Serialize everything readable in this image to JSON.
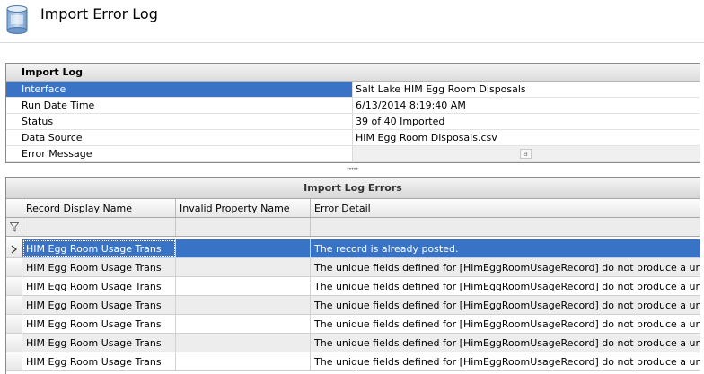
{
  "header": {
    "title": "Import Error Log",
    "icon": "database-icon"
  },
  "import_log": {
    "title": "Import Log",
    "rows": [
      {
        "label": "Interface",
        "value": "Salt Lake HIM Egg Room Disposals"
      },
      {
        "label": "Run Date Time",
        "value": "6/13/2014 8:19:40 AM"
      },
      {
        "label": "Status",
        "value": "39 of 40 Imported"
      },
      {
        "label": "Data Source",
        "value": "HIM Egg Room Disposals.csv"
      },
      {
        "label": "Error Message",
        "value": ""
      }
    ],
    "edit_button_glyph": "a",
    "selection_color": "#3973c6"
  },
  "errors": {
    "title": "Import Log Errors",
    "columns": [
      "Record Display Name",
      "Invalid Property Name",
      "Error Detail"
    ],
    "filter_icon": "filter-icon",
    "row_indicator_icon": "chevron-right-icon",
    "rows": [
      {
        "record": "HIM Egg Room Usage Trans",
        "property": "",
        "detail": "The record is already posted."
      },
      {
        "record": "HIM Egg Room Usage Trans",
        "property": "",
        "detail": "The unique fields defined for [HimEggRoomUsageRecord] do not produce a unique result."
      },
      {
        "record": "HIM Egg Room Usage Trans",
        "property": "",
        "detail": "The unique fields defined for [HimEggRoomUsageRecord] do not produce a unique result."
      },
      {
        "record": "HIM Egg Room Usage Trans",
        "property": "",
        "detail": "The unique fields defined for [HimEggRoomUsageRecord] do not produce a unique result."
      },
      {
        "record": "HIM Egg Room Usage Trans",
        "property": "",
        "detail": "The unique fields defined for [HimEggRoomUsageRecord] do not produce a unique result."
      },
      {
        "record": "HIM Egg Room Usage Trans",
        "property": "",
        "detail": "The unique fields defined for [HimEggRoomUsageRecord] do not produce a unique result."
      },
      {
        "record": "HIM Egg Room Usage Trans",
        "property": "",
        "detail": "The unique fields defined for [HimEggRoomUsageRecord] do not produce a unique result."
      }
    ]
  }
}
